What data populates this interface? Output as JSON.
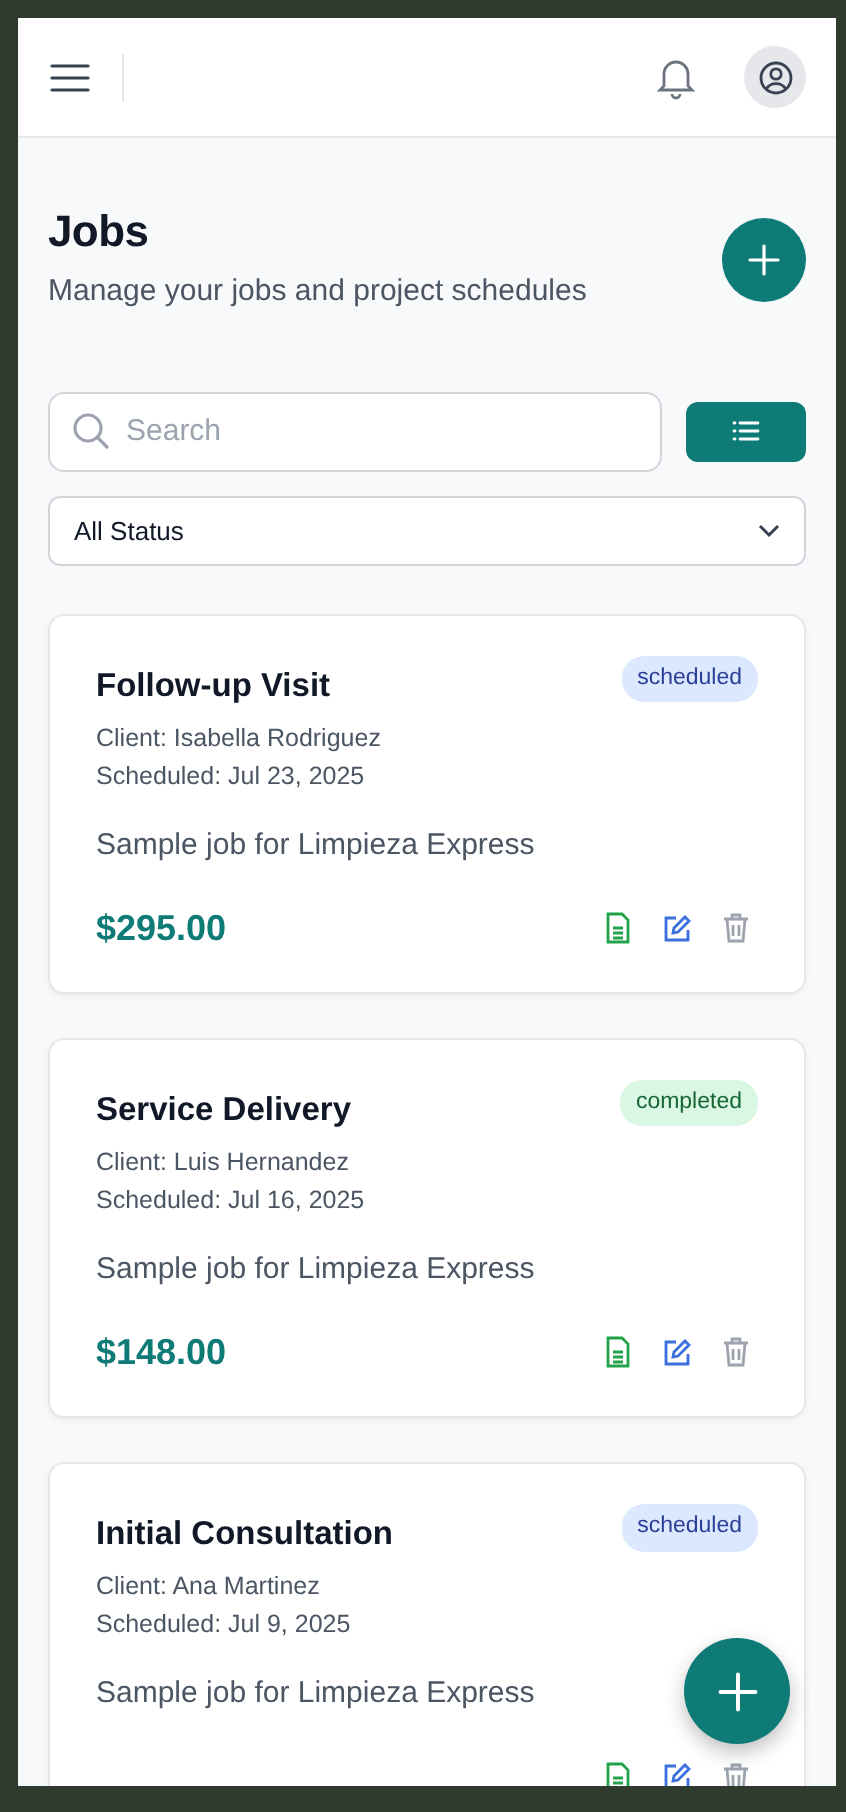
{
  "page": {
    "title": "Jobs",
    "subtitle": "Manage your jobs and project schedules"
  },
  "search": {
    "placeholder": "Search"
  },
  "status_filter": {
    "value": "All Status"
  },
  "jobs": [
    {
      "title": "Follow-up Visit",
      "status": "scheduled",
      "kind": "scheduled",
      "client": "Client: Isabella Rodriguez",
      "scheduled": "Scheduled: Jul 23, 2025",
      "description": "Sample job for Limpieza Express",
      "price": "$295.00"
    },
    {
      "title": "Service Delivery",
      "status": "completed",
      "kind": "completed",
      "client": "Client: Luis Hernandez",
      "scheduled": "Scheduled: Jul 16, 2025",
      "description": "Sample job for Limpieza Express",
      "price": "$148.00"
    },
    {
      "title": "Initial Consultation",
      "status": "scheduled",
      "kind": "scheduled",
      "client": "Client: Ana Martinez",
      "scheduled": "Scheduled: Jul 9, 2025",
      "description": "Sample job for Limpieza Express"
    }
  ]
}
